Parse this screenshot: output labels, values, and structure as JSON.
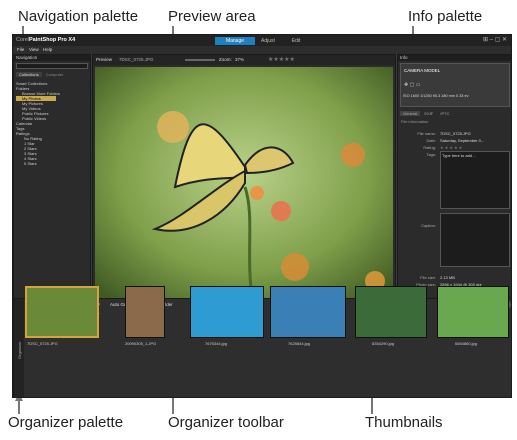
{
  "callouts": {
    "navigation_palette": "Navigation palette",
    "preview_area": "Preview area",
    "info_palette": "Info palette",
    "organizer_palette": "Organizer palette",
    "organizer_toolbar": "Organizer toolbar",
    "thumbnails": "Thumbnails"
  },
  "app": {
    "title_prefix": "Corel",
    "title": "PaintShop Pro X4",
    "mode_tabs": [
      "Manage",
      "Adjust",
      "Edit"
    ],
    "active_mode": "Manage",
    "menu": [
      "File",
      "View",
      "Help"
    ]
  },
  "navigation": {
    "header": "Navigation",
    "tabs": [
      "Collections",
      "Computer"
    ],
    "tree": [
      "Smart Collections",
      "Folders",
      "Browse More Folders",
      "My Photos",
      "My Pictures",
      "My Videos",
      "Public Pictures",
      "Public Videos",
      "Calendar",
      "Tags",
      "Ratings",
      "No Rating",
      "1 Star",
      "2 Stars",
      "3 Stars",
      "4 Stars",
      "5 Stars"
    ]
  },
  "preview": {
    "label": "Preview",
    "filename": "7DSC_0725.JPG",
    "zoom_label": "Zoom:",
    "zoom_value": "37%"
  },
  "info": {
    "header": "Info",
    "camera_model": "CAMERA MODEL",
    "camera_stats": [
      "ISO 1600",
      "1/1250",
      "f/5.3",
      "180 mm",
      "0.33 ev"
    ],
    "tabs": [
      "General",
      "EXIF",
      "IPTC"
    ],
    "section": "File information",
    "fields": [
      {
        "label": "File name:",
        "value": "7DSC_0725.JPG"
      },
      {
        "label": "Date:",
        "value": "Saturday, September 0..."
      },
      {
        "label": "Rating:",
        "value": "★ ★ ★ ★ ★"
      },
      {
        "label": "Tags:",
        "value": "Type here to add ..."
      },
      {
        "label": "Caption:",
        "value": ""
      },
      {
        "label": "File size:",
        "value": "2.13 MB"
      },
      {
        "label": "Photo size:",
        "value": "2896 x 1944 @ 300 dpi"
      }
    ]
  },
  "organizer": {
    "toolbar": {
      "auto_group": "Auto Group",
      "sort_by": "Sort by:",
      "sort_value": "Folder"
    },
    "tabs": [
      "My Photos (57)",
      "My Tray"
    ],
    "side_label": "Organizer",
    "thumbnails": [
      {
        "name": "7DSC_0725.JPG",
        "color": "#6a8a3a"
      },
      {
        "name": "20090305_1.JPG",
        "color": "#8a6a4a"
      },
      {
        "name": "7675344.jpg",
        "color": "#2f9bd3"
      },
      {
        "name": "7625844.jpg",
        "color": "#3a7fb5"
      },
      {
        "name": "8354290.jpg",
        "color": "#3c6b3a"
      },
      {
        "name": "6654860.jpg",
        "color": "#6aa84f"
      }
    ]
  }
}
